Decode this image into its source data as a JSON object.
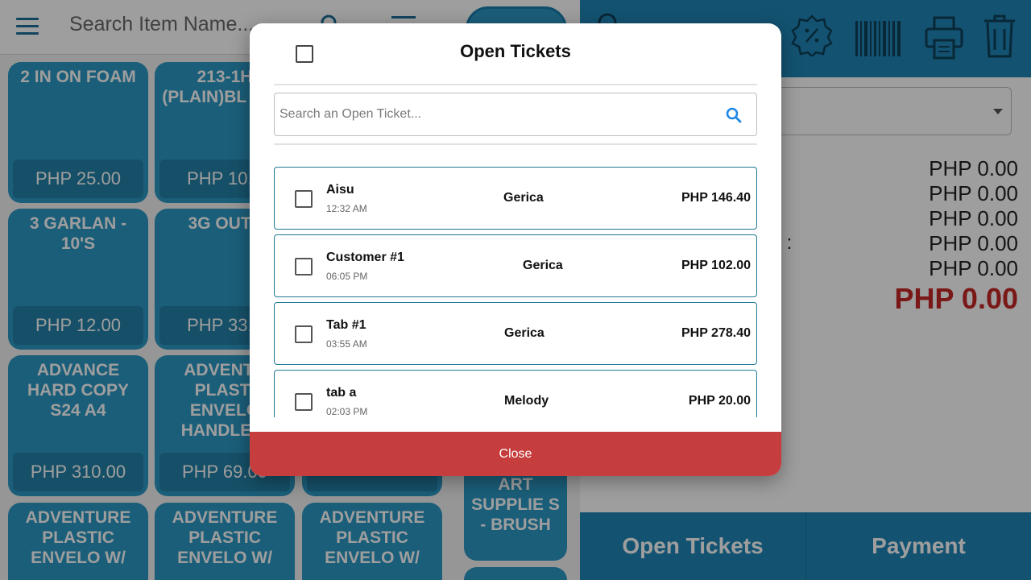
{
  "topbar": {
    "search_placeholder": "Search Item Name...",
    "icons": [
      "menu-icon",
      "search-icon",
      "list-icon"
    ]
  },
  "products": [
    {
      "name": "2 IN ON FOAM",
      "price": "PHP 25.00"
    },
    {
      "name": "213-1H (PLAIN)BL TALI",
      "price": "PHP 10.0"
    },
    {
      "name": "3 GARLAN - 10'S",
      "price": "PHP 12.00"
    },
    {
      "name": "3G OUTL",
      "price": "PHP 33.0"
    },
    {
      "name": "ADVANCE HARD COPY S24 A4",
      "price": "PHP 310.00"
    },
    {
      "name": "ADVENTU PLASTI ENVELO HANDLE B",
      "price": "PHP 69.00"
    },
    {
      "name": "ADVENTURE PLASTIC ENVELO W/",
      "price": ""
    },
    {
      "name": "ADVENTURE PLASTIC ENVELO W/",
      "price": ""
    },
    {
      "name": "ADVENTURE PLASTIC ENVELO W/",
      "price": ""
    }
  ],
  "category_fragment": {
    "name": "ART SUPPLIE S - BRUSH"
  },
  "right_panel": {
    "icons": [
      "search-icon",
      "discount-icon",
      "barcode-icon",
      "printer-icon",
      "trash-icon"
    ],
    "summary_values": [
      "PHP 0.00",
      "PHP 0.00",
      "PHP 0.00",
      "PHP 0.00",
      "PHP 0.00"
    ],
    "label_fragment": ") :",
    "total": "PHP 0.00",
    "total_color": "#c62828",
    "open_tickets_label": "Open Tickets",
    "payment_label": "Payment"
  },
  "modal": {
    "title": "Open Tickets",
    "search_placeholder": "Search an Open Ticket...",
    "tickets": [
      {
        "name": "Aisu",
        "time": "12:32 AM",
        "staff": "Gerica",
        "amount": "PHP 146.40"
      },
      {
        "name": "Customer #1",
        "time": "06:05 PM",
        "staff": "Gerica",
        "amount": "PHP 102.00"
      },
      {
        "name": "Tab #1",
        "time": "03:55 AM",
        "staff": "Gerica",
        "amount": "PHP 278.40"
      },
      {
        "name": "tab a",
        "time": "02:03 PM",
        "staff": "Melody",
        "amount": "PHP 20.00"
      }
    ],
    "close_label": "Close",
    "close_color": "#c53d3d",
    "accent_color": "#1f86b7"
  }
}
